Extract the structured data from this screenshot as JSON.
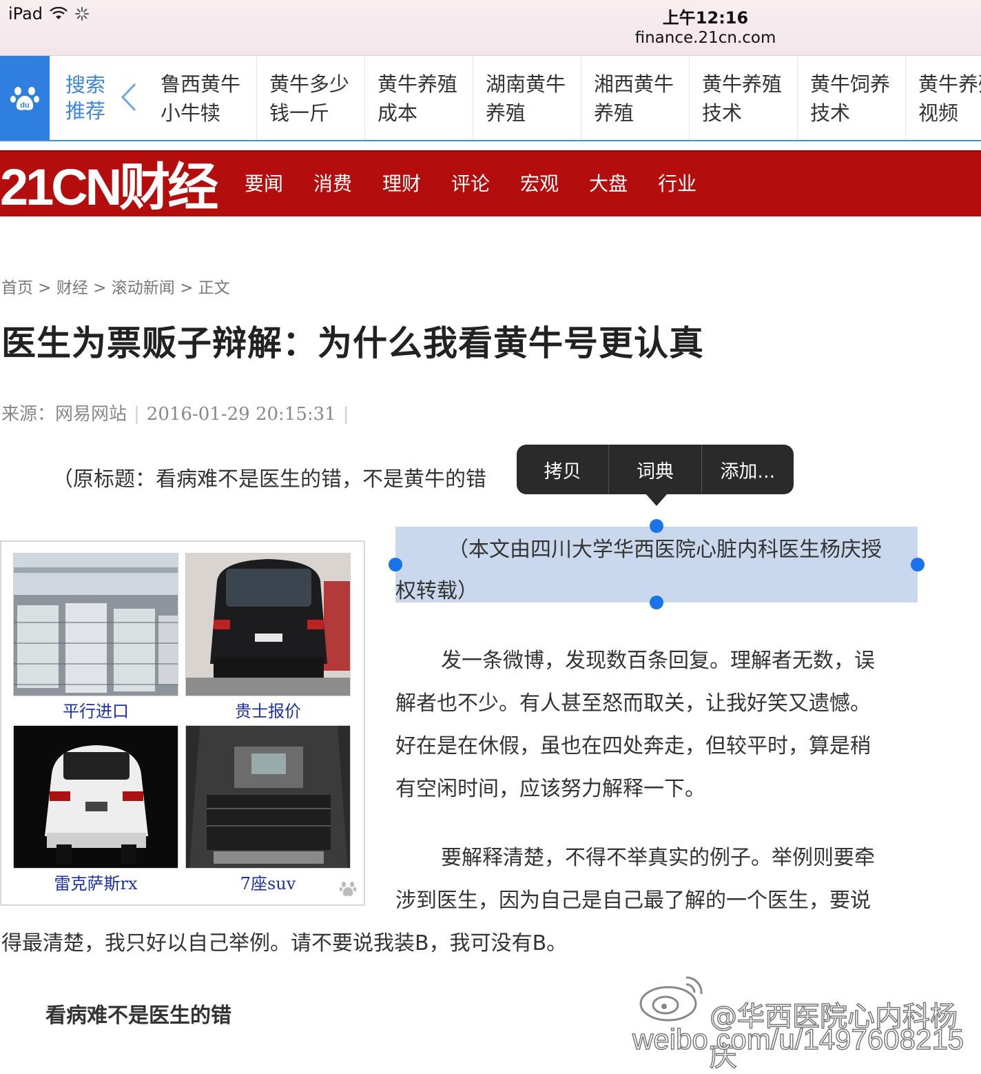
{
  "status": {
    "device": "iPad",
    "time": "上午12:16",
    "url": "finance.21cn.com"
  },
  "baidu_bar": {
    "hint_line1": "搜索",
    "hint_line2": "推荐",
    "items": [
      {
        "l1": "鲁西黄牛",
        "l2": "小牛犊"
      },
      {
        "l1": "黄牛多少",
        "l2": "钱一斤"
      },
      {
        "l1": "黄牛养殖",
        "l2": "成本"
      },
      {
        "l1": "湖南黄牛",
        "l2": "养殖"
      },
      {
        "l1": "湘西黄牛",
        "l2": "养殖"
      },
      {
        "l1": "黄牛养殖",
        "l2": "技术"
      },
      {
        "l1": "黄牛饲养",
        "l2": "技术"
      },
      {
        "l1": "黄牛养殖",
        "l2": "视频"
      }
    ]
  },
  "site": {
    "brand": "21CN财经",
    "nav": [
      "要闻",
      "消费",
      "理财",
      "评论",
      "宏观",
      "大盘",
      "行业"
    ]
  },
  "article": {
    "breadcrumb": "首页 > 财经 > 滚动新闻 > 正文",
    "title": "医生为票贩子辩解：为什么我看黄牛号更认真",
    "source": "来源：网易网站",
    "date": "2016-01-29 20:15:31",
    "para_original_title": "（原标题：看病难不是医生的错，不是黄牛的错",
    "selected_line1": "（本文由四川大学华西医院心脏内科医生杨庆授",
    "selected_line2": "权转载）",
    "p2": [
      "发一条微博，发现数百条回复。理解者无数，误",
      "解者也不少。有人甚至怒而取关，让我好笑又遗憾。",
      "好在是在休假，虽也在四处奔走，但较平时，算是稍",
      "有空闲时间，应该努力解释一下。"
    ],
    "p3": [
      "要解释清楚，不得不举真实的例子。举例则要牵",
      "涉到医生，因为自己是自己最了解的一个医生，要说"
    ],
    "p3_last": "得最清楚，我只好以自己举例。请不要说我装B，我可没有B。",
    "subhead": "看病难不是医生的错"
  },
  "context_menu": [
    "拷贝",
    "词典",
    "添加..."
  ],
  "ads": [
    {
      "caption": "平行进口"
    },
    {
      "caption": "贵士报价"
    },
    {
      "caption": "雷克萨斯rx"
    },
    {
      "caption": "7座suv"
    }
  ],
  "watermark": {
    "line1": "@华西医院心内科杨庆",
    "line2": "weibo.com/u/1497608215"
  }
}
